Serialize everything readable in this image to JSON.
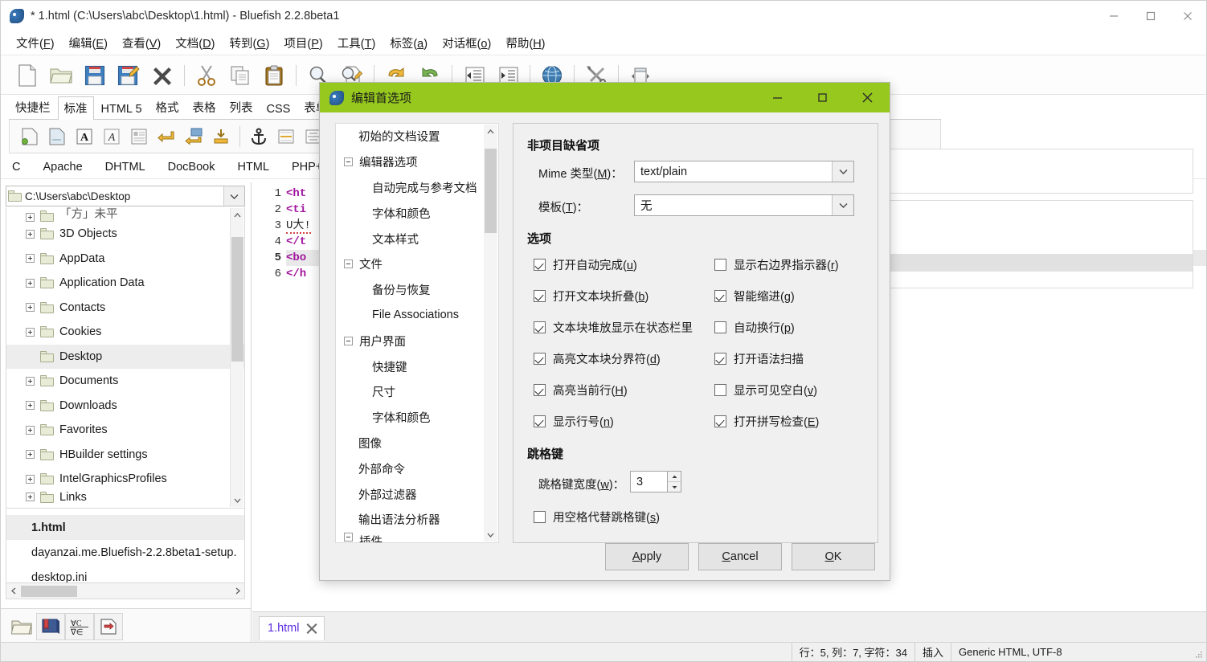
{
  "window": {
    "title": "* 1.html (C:\\Users\\abc\\Desktop\\1.html) - Bluefish 2.2.8beta1",
    "app_icon": "bluefish-icon",
    "minimize": "minimize-icon",
    "maximize": "maximize-icon",
    "close": "close-icon"
  },
  "menubar": [
    {
      "label": "文件",
      "accel": "F"
    },
    {
      "label": "编辑",
      "accel": "E"
    },
    {
      "label": "查看",
      "accel": "V"
    },
    {
      "label": "文档",
      "accel": "D"
    },
    {
      "label": "转到",
      "accel": "G"
    },
    {
      "label": "项目",
      "accel": "P"
    },
    {
      "label": "工具",
      "accel": "T"
    },
    {
      "label": "标签",
      "accel": "a"
    },
    {
      "label": "对话框",
      "accel": "o"
    },
    {
      "label": "帮助",
      "accel": "H"
    }
  ],
  "toolbar": [
    {
      "name": "new-file-icon"
    },
    {
      "name": "open-file-icon"
    },
    {
      "name": "save-icon"
    },
    {
      "name": "save-as-icon"
    },
    {
      "name": "close-file-icon"
    },
    {
      "name": "separator"
    },
    {
      "name": "cut-icon"
    },
    {
      "name": "copy-icon"
    },
    {
      "name": "paste-icon"
    },
    {
      "name": "separator"
    },
    {
      "name": "find-icon"
    },
    {
      "name": "find-replace-icon"
    },
    {
      "name": "separator"
    },
    {
      "name": "undo-icon"
    },
    {
      "name": "redo-icon"
    },
    {
      "name": "separator"
    },
    {
      "name": "unindent-icon"
    },
    {
      "name": "indent-icon"
    },
    {
      "name": "separator"
    },
    {
      "name": "preview-browser-icon"
    },
    {
      "name": "separator"
    },
    {
      "name": "tools-icon"
    },
    {
      "name": "separator"
    },
    {
      "name": "fullscreen-icon"
    }
  ],
  "tabstrip": {
    "tabs": [
      "快捷栏",
      "标准",
      "HTML 5",
      "格式",
      "表格",
      "列表",
      "CSS",
      "表单"
    ],
    "active_index": 1
  },
  "toolbar2": [
    {
      "name": "quickstart-icon"
    },
    {
      "name": "body-icon"
    },
    {
      "name": "bold-icon"
    },
    {
      "name": "italic-icon"
    },
    {
      "name": "paragraph-icon"
    },
    {
      "name": "break-icon"
    },
    {
      "name": "break-clear-icon"
    },
    {
      "name": "non-breaking-space-icon"
    },
    {
      "name": "separator"
    },
    {
      "name": "anchor-icon"
    },
    {
      "name": "rule-icon"
    },
    {
      "name": "center-icon"
    }
  ],
  "languages": [
    "C",
    "Apache",
    "DHTML",
    "DocBook",
    "HTML",
    "PHP+HT"
  ],
  "sidebar": {
    "path_value": "C:\\Users\\abc\\Desktop",
    "path_icon": "folder-icon",
    "dropdown_icon": "chevron-down-icon",
    "tree": [
      {
        "label": "「方」未平",
        "expandable": true,
        "partial": true,
        "selected": false
      },
      {
        "label": "3D Objects",
        "expandable": true,
        "selected": false
      },
      {
        "label": "AppData",
        "expandable": true,
        "selected": false
      },
      {
        "label": "Application Data",
        "expandable": true,
        "selected": false
      },
      {
        "label": "Contacts",
        "expandable": true,
        "selected": false
      },
      {
        "label": "Cookies",
        "expandable": true,
        "selected": false
      },
      {
        "label": "Desktop",
        "expandable": false,
        "selected": true
      },
      {
        "label": "Documents",
        "expandable": true,
        "selected": false
      },
      {
        "label": "Downloads",
        "expandable": true,
        "selected": false
      },
      {
        "label": "Favorites",
        "expandable": true,
        "selected": false
      },
      {
        "label": "HBuilder settings",
        "expandable": true,
        "selected": false
      },
      {
        "label": "IntelGraphicsProfiles",
        "expandable": true,
        "selected": false
      },
      {
        "label": "Links",
        "expandable": true,
        "partial": true,
        "selected": false
      }
    ],
    "files": [
      {
        "label": "1.html",
        "selected": true
      },
      {
        "label": "dayanzai.me.Bluefish-2.2.8beta1-setup.",
        "selected": false
      },
      {
        "label": "desktop.ini",
        "selected": false
      }
    ],
    "bottom_tools": [
      {
        "name": "file-browser-icon"
      },
      {
        "name": "bookmarks-icon"
      },
      {
        "name": "char-map-icon"
      },
      {
        "name": "snippets-icon"
      }
    ]
  },
  "editor": {
    "line_numbers": [
      "1",
      "2",
      "3",
      "4",
      "5",
      "6"
    ],
    "current_line": 5,
    "lines": [
      {
        "text": "<ht",
        "kind": "tag"
      },
      {
        "text": "<ti",
        "kind": "tag"
      },
      {
        "text": "U大!",
        "kind": "plain"
      },
      {
        "text": "</t",
        "kind": "tag"
      },
      {
        "text": "<bo",
        "kind": "tag"
      },
      {
        "text": "</h",
        "kind": "tag"
      }
    ]
  },
  "doctab": {
    "label": "1.html",
    "close_icon": "close-icon"
  },
  "statusbar": {
    "position": "行：5, 列：7, 字符：34",
    "mode": "插入",
    "doctype": "Generic HTML, UTF-8",
    "grip": "resize-grip-icon"
  },
  "dialog": {
    "title": "编辑首选项",
    "icon": "bluefish-icon",
    "minimize": "minimize-icon",
    "maximize": "maximize-icon",
    "close": "close-icon",
    "title_color": "#96c81e",
    "tree": [
      {
        "label": "初始的文档设置",
        "level": 0,
        "expander": false
      },
      {
        "label": "编辑器选项",
        "level": 0,
        "expander": true
      },
      {
        "label": "自动完成与参考文档",
        "level": 1,
        "expander": false
      },
      {
        "label": "字体和颜色",
        "level": 1,
        "expander": false
      },
      {
        "label": "文本样式",
        "level": 1,
        "expander": false
      },
      {
        "label": "文件",
        "level": 0,
        "expander": true
      },
      {
        "label": "备份与恢复",
        "level": 1,
        "expander": false
      },
      {
        "label": "File Associations",
        "level": 1,
        "expander": false
      },
      {
        "label": "用户界面",
        "level": 0,
        "expander": true
      },
      {
        "label": "快捷键",
        "level": 1,
        "expander": false
      },
      {
        "label": "尺寸",
        "level": 1,
        "expander": false
      },
      {
        "label": "字体和颜色",
        "level": 1,
        "expander": false
      },
      {
        "label": "图像",
        "level": 0,
        "expander": false
      },
      {
        "label": "外部命令",
        "level": 0,
        "expander": false
      },
      {
        "label": "外部过滤器",
        "level": 0,
        "expander": false
      },
      {
        "label": "输出语法分析器",
        "level": 0,
        "expander": false
      },
      {
        "label": "插件",
        "level": 0,
        "expander": true,
        "partial": true
      }
    ],
    "section_defaults": {
      "title": "非项目缺省项",
      "mime_label": "Mime 类型",
      "mime_accel": "M",
      "mime_value": "text/plain",
      "template_label": "模板",
      "template_accel": "T",
      "template_value": "无",
      "dropdown_icon": "chevron-down-icon"
    },
    "section_options": {
      "title": "选项",
      "left": [
        {
          "label": "打开自动完成",
          "accel": "u",
          "checked": true
        },
        {
          "label": "打开文本块折叠",
          "accel": "b",
          "checked": true
        },
        {
          "label": "文本块堆放显示在状态栏里",
          "accel": "",
          "checked": true
        },
        {
          "label": "高亮文本块分界符",
          "accel": "d",
          "checked": true
        },
        {
          "label": "高亮当前行",
          "accel": "H",
          "checked": true
        },
        {
          "label": "显示行号",
          "accel": "n",
          "checked": true
        }
      ],
      "right": [
        {
          "label": "显示右边界指示器",
          "accel": "r",
          "checked": false
        },
        {
          "label": "智能缩进",
          "accel": "g",
          "checked": true
        },
        {
          "label": "自动换行",
          "accel": "p",
          "checked": false
        },
        {
          "label": "打开语法扫描",
          "accel": "",
          "checked": true
        },
        {
          "label": "显示可见空白",
          "accel": "v",
          "checked": false
        },
        {
          "label": "打开拼写检查",
          "accel": "E",
          "checked": true
        }
      ]
    },
    "section_tab": {
      "title": "跳格键",
      "width_label": "跳格键宽度",
      "width_accel": "w",
      "width_value": "3",
      "spaces_label": "用空格代替跳格键",
      "spaces_accel": "s",
      "spaces_checked": false,
      "spin_up_icon": "chevron-up-icon",
      "spin_down_icon": "chevron-down-icon"
    },
    "buttons": [
      {
        "label": "Apply",
        "accel": "A"
      },
      {
        "label": "Cancel",
        "accel": "C"
      },
      {
        "label": "OK",
        "accel": "O"
      }
    ]
  }
}
